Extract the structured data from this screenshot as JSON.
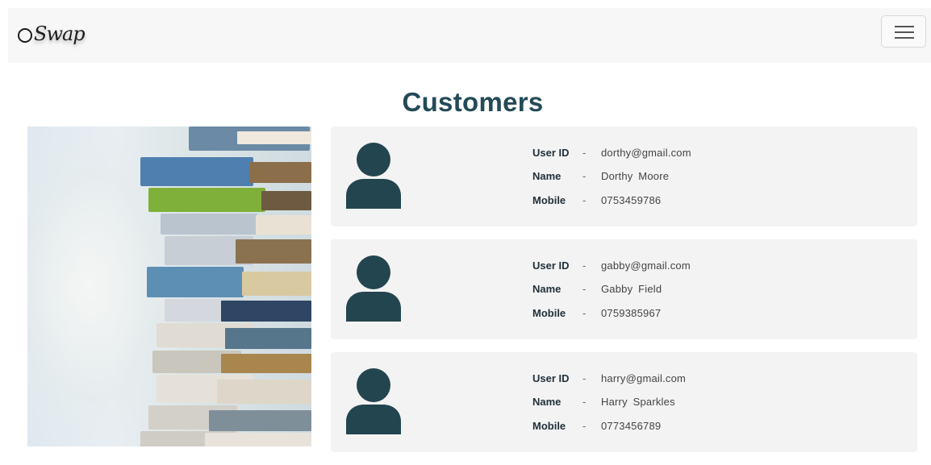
{
  "navbar": {
    "brand": "Swap",
    "menu_icon": "hamburger-menu-icon"
  },
  "page": {
    "title": "Customers"
  },
  "hero_image": {
    "description_icon": "stack-of-books-image"
  },
  "labels": {
    "user_id": "User ID",
    "name": "Name",
    "mobile": "Mobile",
    "separator": "-"
  },
  "customers": [
    {
      "user_id": "dorthy@gmail.com",
      "name": "Dorthy  Moore",
      "mobile": "0753459786",
      "icon": "user-avatar-icon"
    },
    {
      "user_id": "gabby@gmail.com",
      "name": "Gabby  Field",
      "mobile": "0759385967",
      "icon": "user-avatar-icon"
    },
    {
      "user_id": "harry@gmail.com",
      "name": "Harry  Sparkles",
      "mobile": "0773456789",
      "icon": "user-avatar-icon"
    }
  ],
  "colors": {
    "title": "#234a57",
    "avatar": "#23454f",
    "card_bg": "#f3f3f3",
    "navbar_bg": "#f7f7f7"
  }
}
